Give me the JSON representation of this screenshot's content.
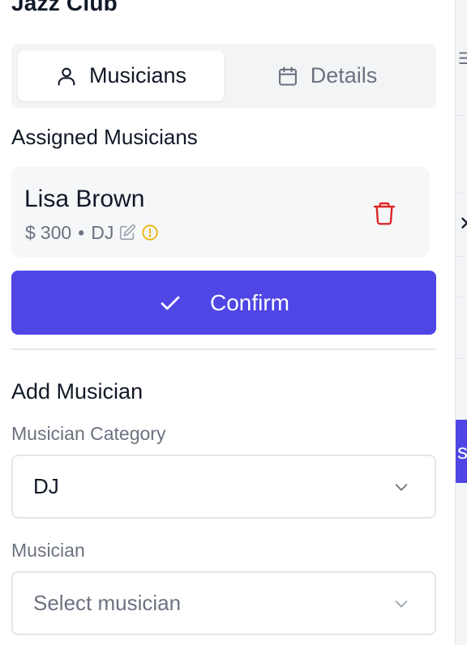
{
  "panel": {
    "title": "Jazz Club"
  },
  "tabs": [
    {
      "label": "Musicians",
      "icon": "user-icon",
      "active": true
    },
    {
      "label": "Details",
      "icon": "calendar-icon",
      "active": false
    }
  ],
  "assigned": {
    "heading": "Assigned Musicians",
    "musicians": [
      {
        "name": "Lisa Brown",
        "currency": "$",
        "fee": "300",
        "separator": "•",
        "category": "DJ",
        "icons": [
          "edit-icon",
          "warning-circle-icon",
          "trash-icon"
        ]
      }
    ]
  },
  "confirm": {
    "label": "Confirm",
    "icon": "check-icon"
  },
  "add": {
    "heading": "Add Musician",
    "category_label": "Musician Category",
    "category_value": "DJ",
    "musician_label": "Musician",
    "musician_placeholder": "Select musician"
  },
  "colors": {
    "primary": "#4f46e5",
    "danger": "#dc2626",
    "warning": "#eab308",
    "muted": "#6b7280",
    "tab_bg": "#f3f4f6"
  }
}
